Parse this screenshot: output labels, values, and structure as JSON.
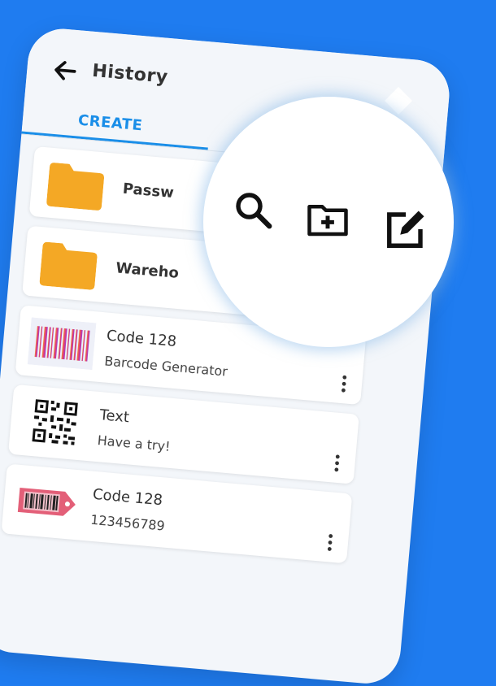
{
  "header": {
    "title": "History"
  },
  "toolbar": {
    "icons": [
      "arrow-left-icon",
      "search-icon",
      "folder-add-icon",
      "edit-icon"
    ]
  },
  "tabs": [
    {
      "label": "CREATE",
      "selected": true
    }
  ],
  "folders": [
    {
      "name": "Passw",
      "icon": "folder-icon",
      "color": "#f4a825"
    },
    {
      "name": "Wareho",
      "icon": "folder-icon",
      "color": "#f4a825"
    }
  ],
  "items": [
    {
      "title": "Code 128",
      "subtitle": "Barcode Generator",
      "thumb": "gradient-barcode"
    },
    {
      "title": "Text",
      "subtitle": "Have a try!",
      "thumb": "qr-code"
    },
    {
      "title": "Code 128",
      "subtitle": "123456789",
      "thumb": "tag-barcode"
    }
  ],
  "colors": {
    "background": "#1f7cf0",
    "accent": "#1a8ee8",
    "folder": "#f4a825"
  }
}
